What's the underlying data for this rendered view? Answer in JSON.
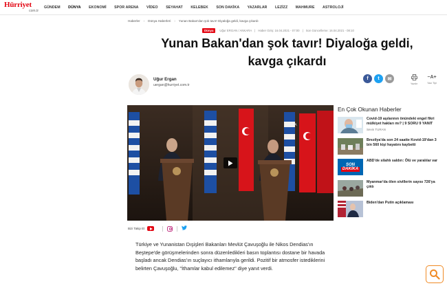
{
  "logo": {
    "brand": "Hürriyet",
    "domain": "com.tr"
  },
  "nav": [
    "GÜNDEM",
    "DÜNYA",
    "EKONOMİ",
    "SPOR ARENA",
    "VİDEO",
    "SEYAHAT",
    "KELEBEK",
    "SON DAKİKA",
    "YAZARLAR",
    "LEZİZZ",
    "MAHMURE",
    "ASTROLOJİ"
  ],
  "breadcrumb": [
    "Haberler",
    "Dünya Haberleri",
    "Yunan Bakan'dan şok tavır! Diyaloğa geldi, kavga çıkardı"
  ],
  "meta": {
    "category": "Dünya",
    "source": "Uğur ERGAN / ANKARA",
    "published": "Haber Giriş: 16.04.2021 - 07:00",
    "updated": "Son Güncelleme: 16.04.2021 - 08:10"
  },
  "article": {
    "title": "Yunan Bakan'dan şok tavır! Diyaloğa geldi, kavga çıkardı",
    "body": "Türkiye ve Yunanistan Dışişleri Bakanları Mevlüt Çavuşoğlu ile Nikos Dendias'ın Beştepe'de görüşmelerinden sonra düzenledikleri basın toplantısı dostane bir havada başladı ancak Dendias'ın suçlayıcı ithamlarıyla gerildi. Pozitif bir atmosfer istediklerini belirten Çavuşoğlu, \"İthamlar kabul edilemez\" diye yanıt verdi."
  },
  "author": {
    "name": "Uğur Ergan",
    "email": "uergan@hurriyet.com.tr"
  },
  "tools": {
    "print_icon": "printer-icon",
    "print_label": "Yazdır",
    "font_icon": "font-size-icon",
    "font_symbol": "−A+",
    "font_label": "Yazı Tipi"
  },
  "share": {
    "facebook": "f",
    "twitter": "t",
    "mail": "✉"
  },
  "follow": {
    "label": "Bizi Takip Et"
  },
  "sidebar": {
    "title": "En Çok Okunan Haberler",
    "items": [
      {
        "text": "Covid-19 aşılarının önündeki engel fikri mülkiyet hakları mı? | 9 SORU 9 YANIT",
        "author": "Sevin TURAN"
      },
      {
        "text": "Brezilya'da son 24 saatte Kovid-19'dan 3 bin 560 kişi hayatını kaybetti",
        "author": ""
      },
      {
        "text": "ABD'de silahlı saldırı: Ölü ve yaralılar var",
        "author": ""
      },
      {
        "text": "Myanmar'da ölen sivillerin sayısı 726'ya çıktı",
        "author": ""
      },
      {
        "text": "Biden'dan Putin açıklaması",
        "author": ""
      }
    ],
    "breaking_badge": [
      "SON",
      "DAKİKA"
    ]
  },
  "colors": {
    "brand_red": "#e30613",
    "facebook": "#3b5998",
    "twitter": "#1da1f2",
    "corner_orange": "#f08a24"
  }
}
